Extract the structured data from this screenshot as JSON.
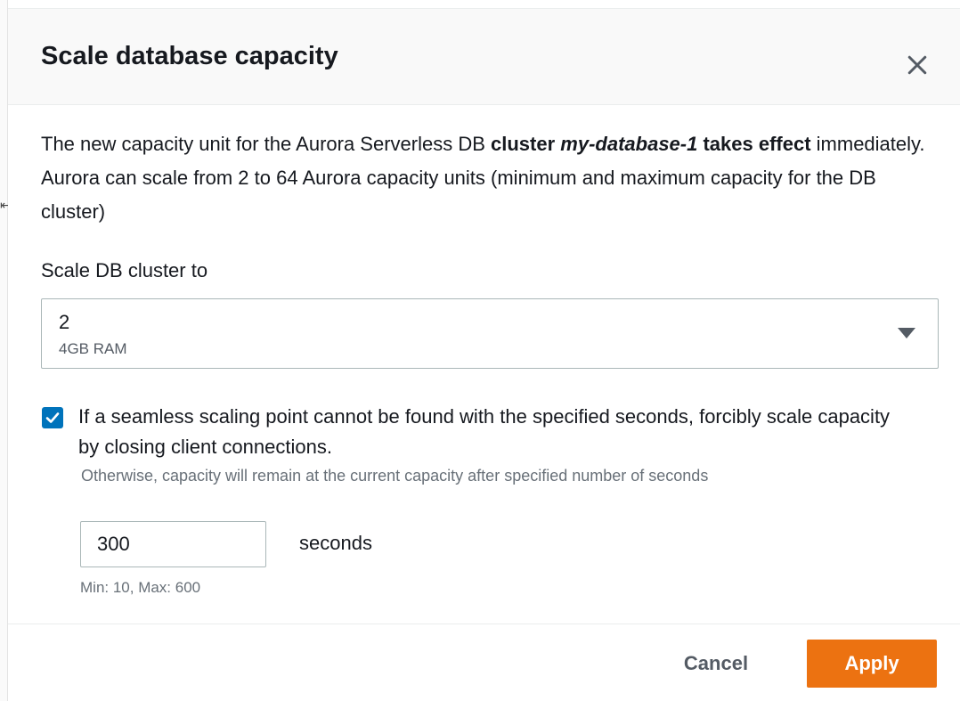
{
  "page_edge": {
    "glyph": "⇤"
  },
  "modal": {
    "title": "Scale database capacity",
    "close_icon": "close-icon",
    "description": {
      "part1": "The new capacity unit for the Aurora Serverless DB ",
      "part2": "cluster ",
      "part3": "my-database-1",
      "part4": " takes effect",
      "part5": " immediately. Aurora can scale from 2 to 64 Aurora capacity units (minimum and maximum capacity for the DB cluster)"
    },
    "scale_field": {
      "label": "Scale DB cluster to",
      "selected_value": "2",
      "selected_sub": "4GB RAM",
      "caret_icon": "caret-down-icon"
    },
    "force_scaling": {
      "checked": true,
      "label": "If a seamless scaling point cannot be found with the specified seconds, forcibly scale capacity by closing client connections.",
      "description": "Otherwise, capacity will remain at the current capacity after specified number of seconds"
    },
    "timeout": {
      "value": "300",
      "unit": "seconds",
      "constraint": "Min: 10, Max: 600"
    },
    "footer": {
      "cancel_label": "Cancel",
      "apply_label": "Apply"
    }
  },
  "colors": {
    "primary_button": "#ec7211",
    "checkbox": "#0073bb",
    "text": "#16191f",
    "secondary_text": "#687078"
  }
}
